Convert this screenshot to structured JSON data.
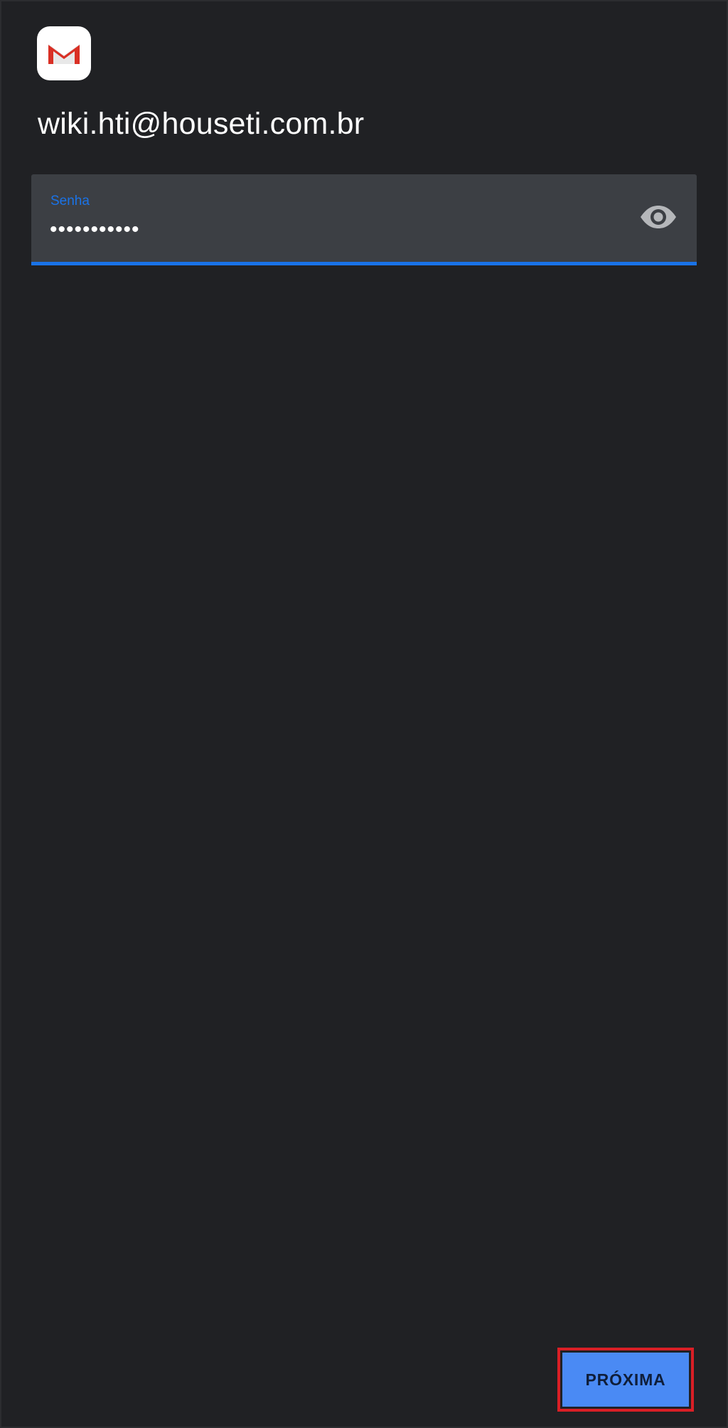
{
  "app": {
    "logo_icon": "gmail-icon",
    "colors": {
      "background": "#202124",
      "accent": "#1a73e8",
      "button": "#4a8af4",
      "highlight_border": "#d91f26"
    }
  },
  "account": {
    "email": "wiki.hti@houseti.com.br"
  },
  "password_field": {
    "label": "Senha",
    "value": "•••••••••••",
    "toggle_icon": "eye-icon"
  },
  "footer": {
    "next_label": "PRÓXIMA"
  }
}
